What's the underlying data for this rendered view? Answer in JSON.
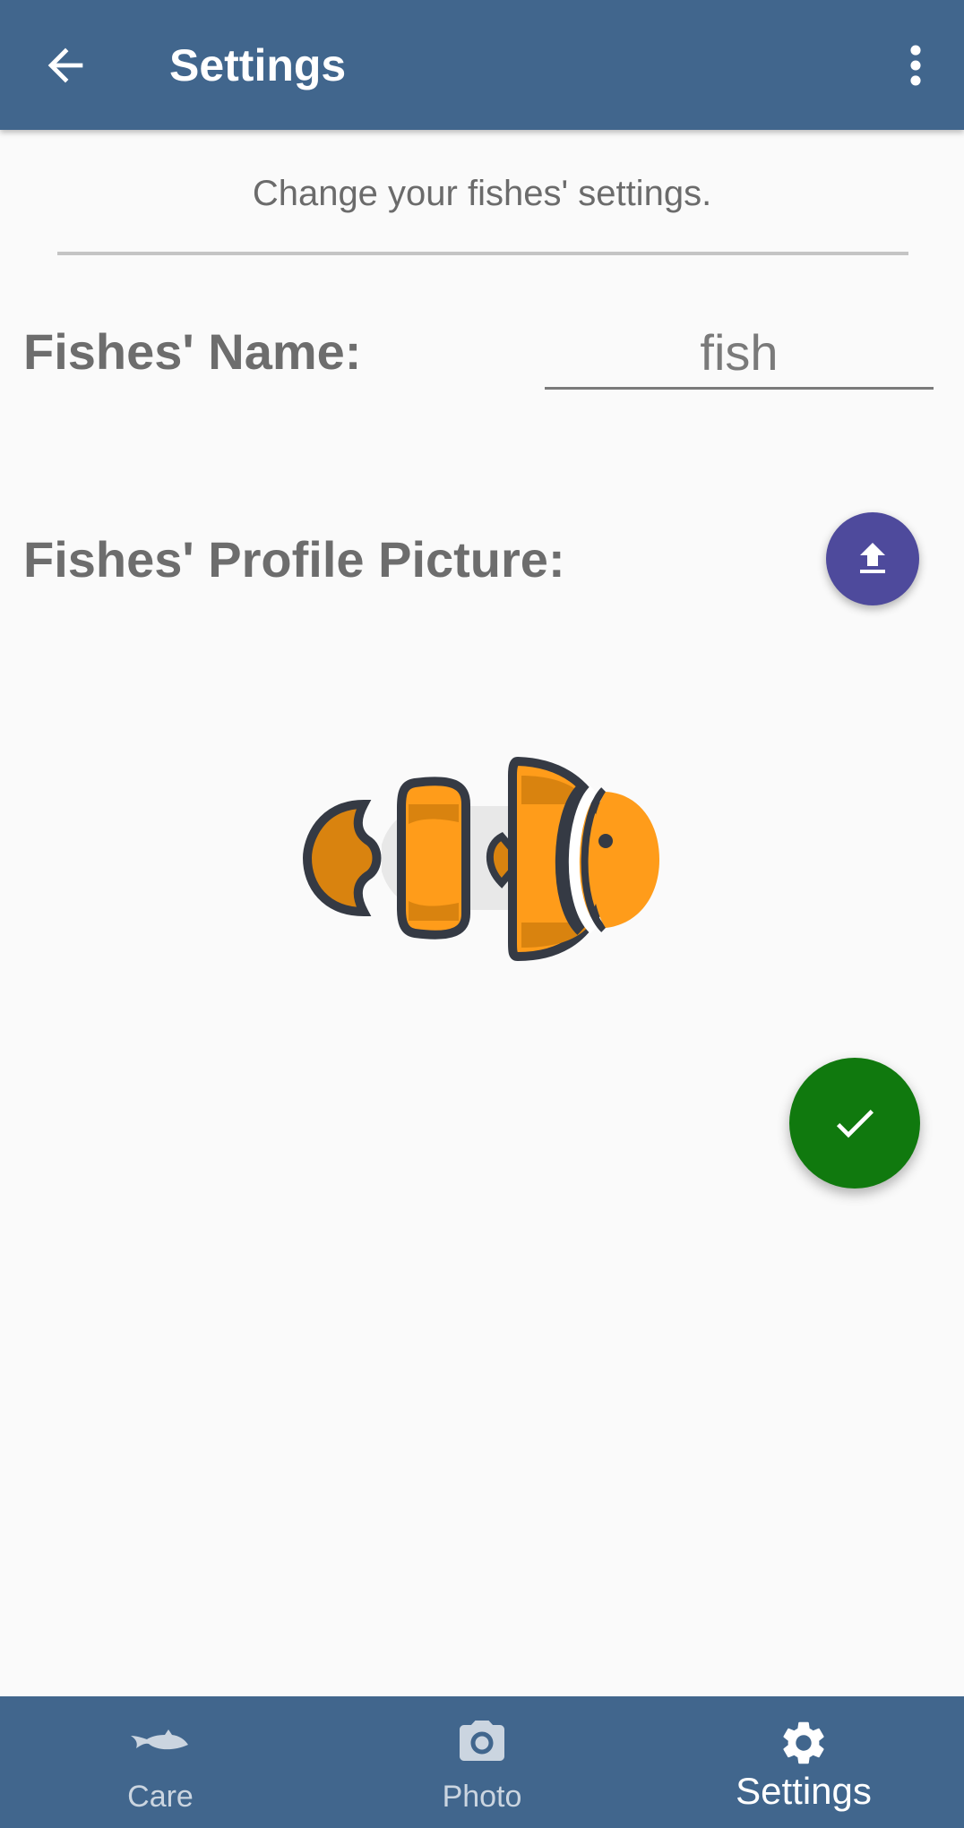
{
  "appbar": {
    "title": "Settings",
    "back_icon": "arrow-left-icon",
    "menu_icon": "more-vert-icon",
    "background": "#41668d"
  },
  "main": {
    "subtitle": "Change your fishes' settings.",
    "name_label": "Fishes' Name:",
    "name_value": "fish",
    "picture_label": "Fishes' Profile Picture:",
    "upload_icon": "upload-icon",
    "upload_color": "#4e4a9c",
    "profile_image": "clownfish-image",
    "confirm_icon": "check-icon",
    "confirm_color": "#10790e"
  },
  "bottom_nav": {
    "items": [
      {
        "label": "Care",
        "icon": "fish-icon",
        "active": false
      },
      {
        "label": "Photo",
        "icon": "camera-icon",
        "active": false
      },
      {
        "label": "Settings",
        "icon": "gear-icon",
        "active": true
      }
    ]
  }
}
